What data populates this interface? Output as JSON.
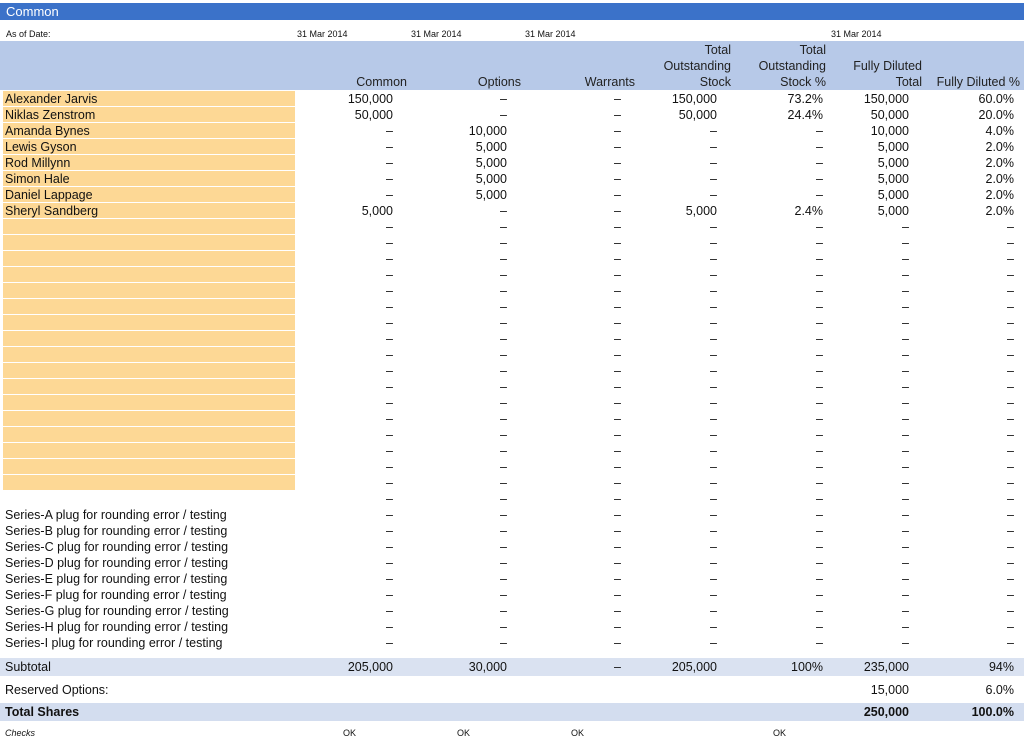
{
  "title": "Common",
  "as_of": {
    "label": "As of Date:",
    "dates": [
      "31 Mar 2014",
      "31 Mar 2014",
      "31 Mar 2014",
      "31 Mar 2014"
    ]
  },
  "columns": {
    "common": "Common",
    "options": "Options",
    "warrants": "Warrants",
    "total_outstanding": "Total\nOutstanding\nStock",
    "total_outstanding_pct": "Total\nOutstanding\nStock %",
    "fully_diluted_total": "Fully Diluted\nTotal",
    "fully_diluted_pct": "Fully Diluted %"
  },
  "dash": "–",
  "holders": [
    {
      "name": "Alexander Jarvis",
      "common": "150,000",
      "options": "–",
      "warrants": "–",
      "total": "150,000",
      "total_pct": "73.2%",
      "fd_total": "150,000",
      "fd_pct": "60.0%"
    },
    {
      "name": "Niklas Zenstrom",
      "common": "50,000",
      "options": "–",
      "warrants": "–",
      "total": "50,000",
      "total_pct": "24.4%",
      "fd_total": "50,000",
      "fd_pct": "20.0%"
    },
    {
      "name": "Amanda Bynes",
      "common": "–",
      "options": "10,000",
      "warrants": "–",
      "total": "–",
      "total_pct": "–",
      "fd_total": "10,000",
      "fd_pct": "4.0%"
    },
    {
      "name": "Lewis Gyson",
      "common": "–",
      "options": "5,000",
      "warrants": "–",
      "total": "–",
      "total_pct": "–",
      "fd_total": "5,000",
      "fd_pct": "2.0%"
    },
    {
      "name": "Rod Millynn",
      "common": "–",
      "options": "5,000",
      "warrants": "–",
      "total": "–",
      "total_pct": "–",
      "fd_total": "5,000",
      "fd_pct": "2.0%"
    },
    {
      "name": "Simon Hale",
      "common": "–",
      "options": "5,000",
      "warrants": "–",
      "total": "–",
      "total_pct": "–",
      "fd_total": "5,000",
      "fd_pct": "2.0%"
    },
    {
      "name": "Daniel Lappage",
      "common": "–",
      "options": "5,000",
      "warrants": "–",
      "total": "–",
      "total_pct": "–",
      "fd_total": "5,000",
      "fd_pct": "2.0%"
    },
    {
      "name": "Sheryl Sandberg",
      "common": "5,000",
      "options": "–",
      "warrants": "–",
      "total": "5,000",
      "total_pct": "2.4%",
      "fd_total": "5,000",
      "fd_pct": "2.0%"
    }
  ],
  "plugs": [
    "Series-A plug for rounding error / testing",
    "Series-B plug for rounding error / testing",
    "Series-C plug for rounding error / testing",
    "Series-D plug for rounding error / testing",
    "Series-E plug for rounding error / testing",
    "Series-F plug for rounding error / testing",
    "Series-G plug for rounding error / testing",
    "Series-H plug for rounding error / testing",
    "Series-I plug for rounding error / testing"
  ],
  "subtotal": {
    "label": "Subtotal",
    "common": "205,000",
    "options": "30,000",
    "warrants": "–",
    "total": "205,000",
    "total_pct": "100%",
    "fd_total": "235,000",
    "fd_pct": "94%"
  },
  "reserved": {
    "label": "Reserved Options:",
    "fd_total": "15,000",
    "fd_pct": "6.0%"
  },
  "total_shares": {
    "label": "Total Shares",
    "fd_total": "250,000",
    "fd_pct": "100.0%"
  },
  "checks": {
    "label": "Checks",
    "values": [
      "OK",
      "OK",
      "OK",
      "OK"
    ]
  }
}
